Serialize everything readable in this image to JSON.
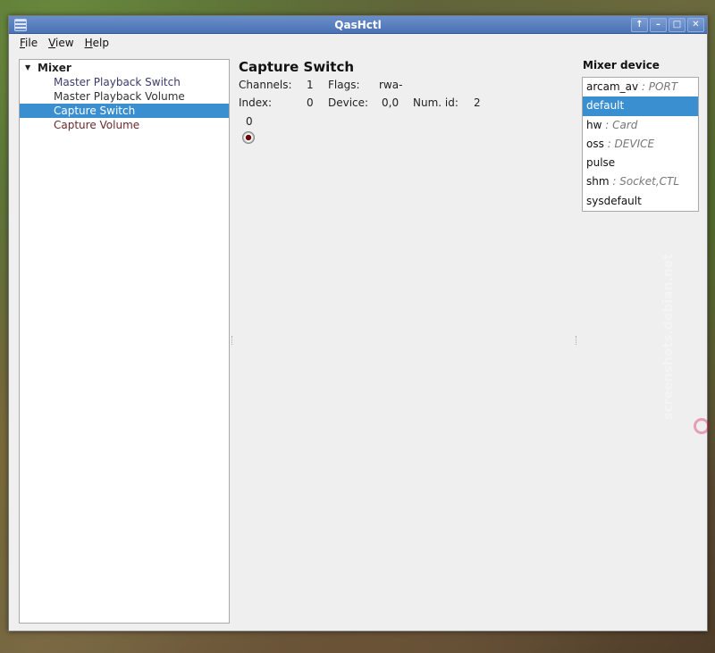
{
  "window": {
    "title": "QasHctl"
  },
  "titlebar_buttons": [
    "↑",
    "–",
    "□",
    "✕"
  ],
  "menu": [
    {
      "label": "File"
    },
    {
      "label": "View"
    },
    {
      "label": "Help"
    }
  ],
  "tree": {
    "root": "Mixer",
    "items": [
      {
        "label": "Master Playback Switch"
      },
      {
        "label": "Master Playback Volume"
      },
      {
        "label": "Capture Switch"
      },
      {
        "label": "Capture Volume"
      }
    ]
  },
  "control": {
    "title": "Capture Switch",
    "channels_label": "Channels:",
    "channels_value": "1",
    "flags_label": "Flags:",
    "flags_value": "rwa-",
    "index_label": "Index:",
    "index_value": "0",
    "device_label": "Device:",
    "device_value": "0,0",
    "numid_label": "Num. id:",
    "numid_value": "2",
    "channel_number": "0"
  },
  "mixer_device": {
    "label": "Mixer device",
    "items": [
      {
        "name": "arcam_av",
        "sub": ": PORT"
      },
      {
        "name": "default",
        "sub": ""
      },
      {
        "name": "hw",
        "sub": ": Card"
      },
      {
        "name": "oss",
        "sub": ": DEVICE"
      },
      {
        "name": "pulse",
        "sub": ""
      },
      {
        "name": "shm",
        "sub": ": Socket,CTL"
      },
      {
        "name": "sysdefault",
        "sub": ""
      }
    ]
  },
  "watermark": "screenshots.debian.net",
  "colors": {
    "selection": "#3a8fd1",
    "titlebar": "#4a72b4"
  }
}
